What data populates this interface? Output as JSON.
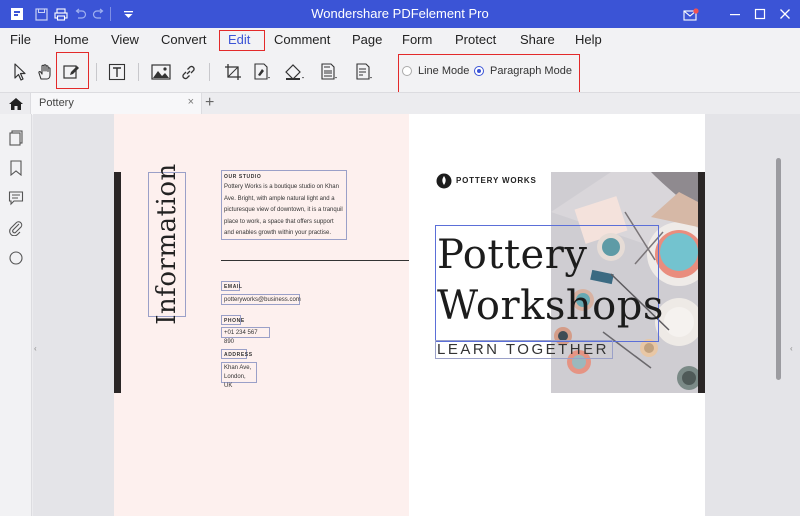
{
  "window": {
    "title": "Wondershare PDFelement Pro",
    "accent": "#3b54d6",
    "highlight": "#e32a2a"
  },
  "titlebar_icons": [
    "app-logo-icon",
    "save-icon",
    "print-icon",
    "undo-icon",
    "redo-icon",
    "quick-access-dropdown-icon",
    "mail-icon",
    "minimize-icon",
    "maximize-icon",
    "close-icon"
  ],
  "menu": {
    "items": [
      {
        "label": "File"
      },
      {
        "label": "Home"
      },
      {
        "label": "View"
      },
      {
        "label": "Convert"
      },
      {
        "label": "Edit",
        "active": true
      },
      {
        "label": "Comment"
      },
      {
        "label": "Page"
      },
      {
        "label": "Form"
      },
      {
        "label": "Protect"
      },
      {
        "label": "Share"
      },
      {
        "label": "Help"
      }
    ]
  },
  "toolbar": {
    "tools": [
      "select-icon",
      "hand-icon",
      "edit-object-icon",
      "add-text-icon",
      "add-image-icon",
      "link-icon",
      "crop-icon",
      "watermark-icon",
      "background-icon",
      "header-footer-icon",
      "bates-number-icon"
    ],
    "modes": {
      "line": "Line Mode",
      "paragraph": "Paragraph Mode",
      "selected": "Paragraph Mode"
    }
  },
  "tabs": {
    "doc_title": "Pottery",
    "close": "×",
    "add": "+"
  },
  "sidebar_icons": [
    "thumbnails-icon",
    "bookmarks-icon",
    "comments-icon",
    "attachments-icon",
    "search-icon"
  ],
  "document": {
    "vertical_title": "Information",
    "studio": {
      "label": "OUR STUDIO",
      "text": "Pottery Works is a boutique studio on Khan Ave. Bright, with ample natural light and a picturesque view of downtown, it is a tranquil place to work, a space that offers support and enables growth within your practise."
    },
    "email": {
      "label": "EMAIL",
      "value": "potteryworks@business.com"
    },
    "phone": {
      "label": "PHONE",
      "value": "+01 234 567 890"
    },
    "address": {
      "label": "ADDRESS",
      "line1": "Khan Ave,",
      "line2": "London, UK"
    },
    "brand": "POTTERY WORKS",
    "headline_1": "Pottery",
    "headline_2": "Workshops",
    "tagline": "LEARN TOGETHER"
  }
}
